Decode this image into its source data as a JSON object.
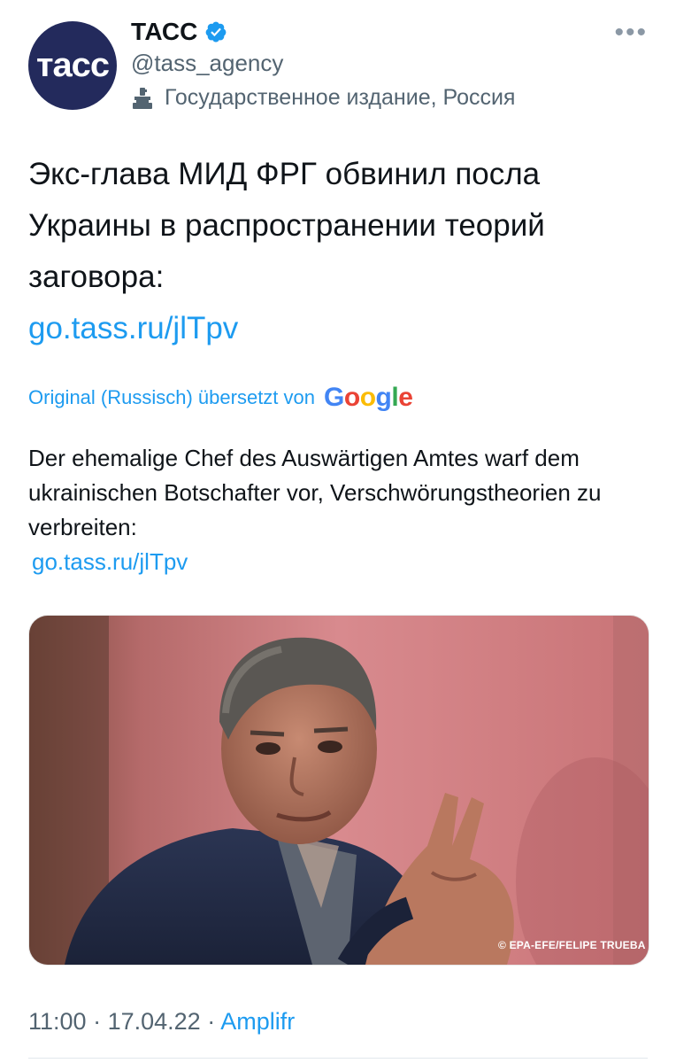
{
  "account": {
    "avatar_text": "тасс",
    "name": "ТАСС",
    "handle": "@tass_agency",
    "label": "Государственное издание, Россия",
    "avatar_color": "#232a5c"
  },
  "tweet": {
    "text": "Экс-глава МИД ФРГ обвинил посла Украины в распространении теорий заговора:",
    "link": "go.tass.ru/jlTpv"
  },
  "translation": {
    "label": "Original (Russisch) übersetzt von",
    "provider": "Google",
    "text": "Der ehemalige Chef des Auswärtigen Amtes warf dem ukrainischen Botschafter vor, Verschwörungstheorien zu verbreiten:",
    "link": "go.tass.ru/jlTpv"
  },
  "media": {
    "credit": "© EPA-EFE/FELIPE TRUEBA"
  },
  "meta": {
    "time": "11:00",
    "date": "17.04.22",
    "source": "Amplifr",
    "separator": "·"
  },
  "colors": {
    "link": "#1d9bf0",
    "secondary_text": "#536471",
    "verified": "#1d9bf0"
  }
}
